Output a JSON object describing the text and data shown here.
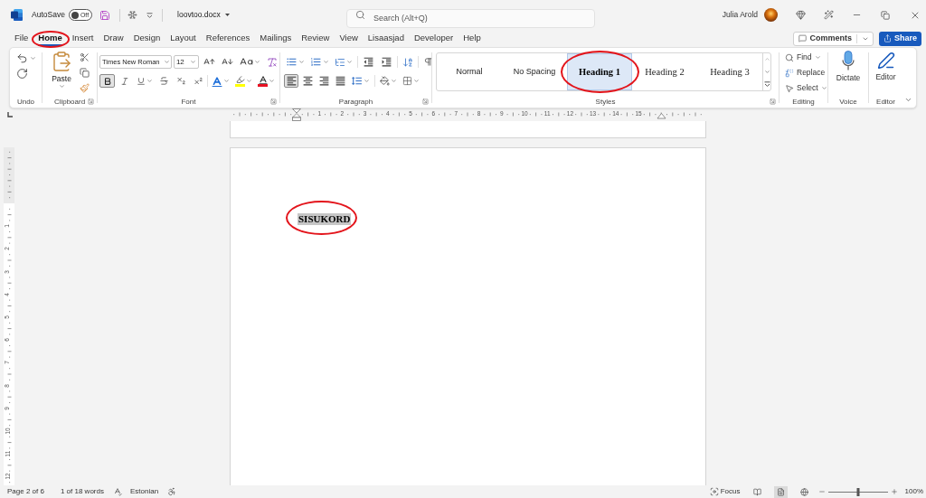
{
  "title_bar": {
    "autosave": {
      "label": "AutoSave",
      "state": "Off",
      "on": false
    },
    "file_name": "loovtoo.docx",
    "search": {
      "placeholder": "Search (Alt+Q)"
    },
    "user_name": "Julia Arold"
  },
  "menu_tabs": [
    {
      "label": "File",
      "selected": false,
      "circled": false
    },
    {
      "label": "Home",
      "selected": true,
      "circled": true
    },
    {
      "label": "Insert",
      "selected": false,
      "circled": false
    },
    {
      "label": "Draw",
      "selected": false,
      "circled": false
    },
    {
      "label": "Design",
      "selected": false,
      "circled": false
    },
    {
      "label": "Layout",
      "selected": false,
      "circled": false
    },
    {
      "label": "References",
      "selected": false,
      "circled": false
    },
    {
      "label": "Mailings",
      "selected": false,
      "circled": false
    },
    {
      "label": "Review",
      "selected": false,
      "circled": false
    },
    {
      "label": "View",
      "selected": false,
      "circled": false
    },
    {
      "label": "Lisaasjad",
      "selected": false,
      "circled": false
    },
    {
      "label": "Developer",
      "selected": false,
      "circled": false
    },
    {
      "label": "Help",
      "selected": false,
      "circled": false
    }
  ],
  "comments_button": {
    "label": "Comments"
  },
  "share_button": {
    "label": "Share"
  },
  "ribbon": {
    "undo": {
      "label": "Undo"
    },
    "clipboard": {
      "label": "Clipboard",
      "paste_label": "Paste"
    },
    "font": {
      "label": "Font",
      "font_name": "Times New Roman",
      "font_size": "12",
      "bold": true
    },
    "paragraph": {
      "label": "Paragraph",
      "alignments": [
        {
          "kind": "left",
          "selected": true
        },
        {
          "kind": "center",
          "selected": false
        },
        {
          "kind": "right",
          "selected": false
        },
        {
          "kind": "justify",
          "selected": false
        }
      ]
    },
    "styles": {
      "label": "Styles",
      "items": [
        {
          "label": "Normal",
          "kind": "plain",
          "selected": false,
          "circled": false
        },
        {
          "label": "No Spacing",
          "kind": "plain",
          "selected": false,
          "circled": false
        },
        {
          "label": "Heading 1",
          "kind": "heading1",
          "selected": true,
          "circled": true
        },
        {
          "label": "Heading 2",
          "kind": "heading2",
          "selected": false,
          "circled": false
        },
        {
          "label": "Heading 3",
          "kind": "heading3",
          "selected": false,
          "circled": false
        }
      ]
    },
    "editing": {
      "label": "Editing",
      "find": "Find",
      "replace": "Replace",
      "select": "Select"
    },
    "voice": {
      "label": "Voice",
      "dictate": "Dictate"
    },
    "editor": {
      "label": "Editor",
      "button_label": "Editor"
    }
  },
  "ruler": {
    "numbers": [
      "1",
      "2",
      "3",
      "4",
      "5",
      "6",
      "7",
      "8",
      "9",
      "10",
      "11",
      "12",
      "13",
      "14",
      "15"
    ]
  },
  "vertical_ruler": {
    "numbers": [
      "1",
      "2",
      "3",
      "4",
      "5",
      "6",
      "7",
      "8",
      "9",
      "10",
      "11",
      "12"
    ]
  },
  "document": {
    "heading": {
      "text": "SISUKORD",
      "selected": true,
      "circled": true
    }
  },
  "status_bar": {
    "page": "Page 2 of 6",
    "word_count": "1 of 18 words",
    "language": "Estonian",
    "focus_label": "Focus",
    "views": [
      {
        "kind": "read",
        "selected": false
      },
      {
        "kind": "print",
        "selected": true
      },
      {
        "kind": "web",
        "selected": false
      }
    ],
    "zoom": {
      "level": 0.5,
      "reading": "100%"
    }
  }
}
